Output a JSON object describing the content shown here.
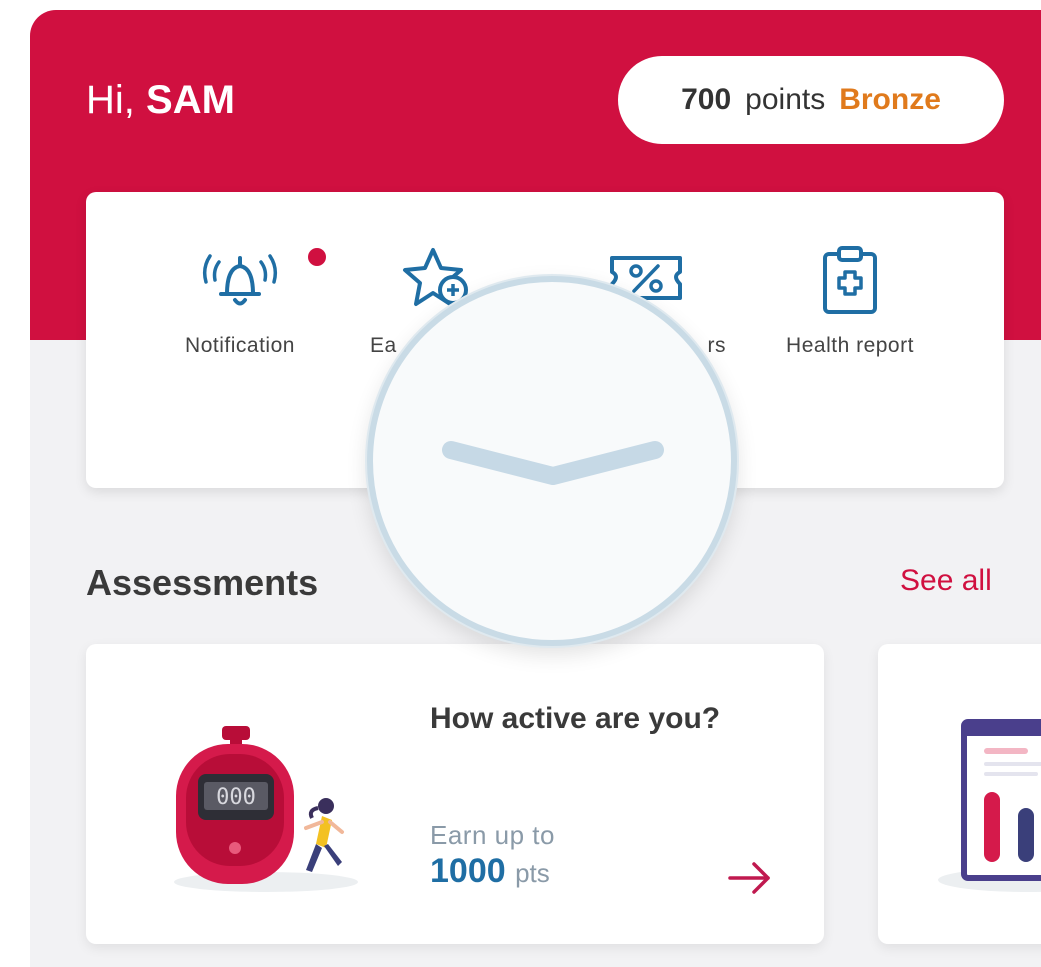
{
  "header": {
    "greeting": "Hi,",
    "user_name": "SAM",
    "points_value": "700",
    "points_label": "points",
    "tier": "Bronze",
    "accent_color": "#d01040",
    "tier_color": "#e07a1c"
  },
  "quick_actions": [
    {
      "label": "Notification",
      "icon": "bell-icon",
      "has_badge": true
    },
    {
      "label": "Ea",
      "icon": "star-plus-icon"
    },
    {
      "label": "rs",
      "icon": "discount-ticket-icon"
    },
    {
      "label": "Health report",
      "icon": "clipboard-medical-icon"
    }
  ],
  "assessments": {
    "title": "Assessments",
    "see_all": "See all",
    "cards": [
      {
        "title": "How active are you?",
        "earn_label": "Earn up to",
        "points": "1000",
        "points_unit": "pts",
        "stopwatch_display": "000"
      }
    ]
  },
  "magnifier": {
    "icon": "chevron-down-icon"
  }
}
